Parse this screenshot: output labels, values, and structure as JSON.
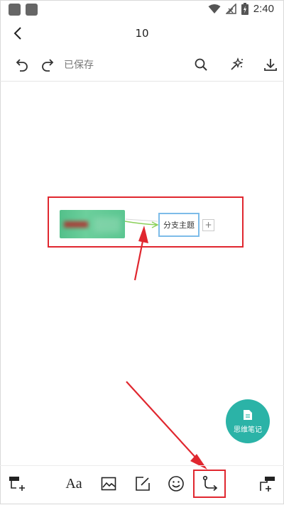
{
  "status_bar": {
    "time": "2:40"
  },
  "nav": {
    "title": "10"
  },
  "toolbar": {
    "save_status": "已保存"
  },
  "canvas": {
    "branch_topic": "分支主题",
    "add_symbol": "+"
  },
  "fab": {
    "label": "思维笔记"
  },
  "bottom_toolbar": {
    "font_button": "Aa"
  },
  "colors": {
    "accent": "#2bb3a7",
    "central_topic": "#5bc691",
    "branch_border": "#7dbce9",
    "annotation_red": "#e0272f"
  },
  "icons": [
    "back-icon",
    "undo-icon",
    "redo-icon",
    "search-icon",
    "magic-wand-icon",
    "download-icon",
    "add-subtopic-icon",
    "image-icon",
    "note-icon",
    "emoji-icon",
    "connect-line-icon",
    "add-floating-topic-icon"
  ]
}
